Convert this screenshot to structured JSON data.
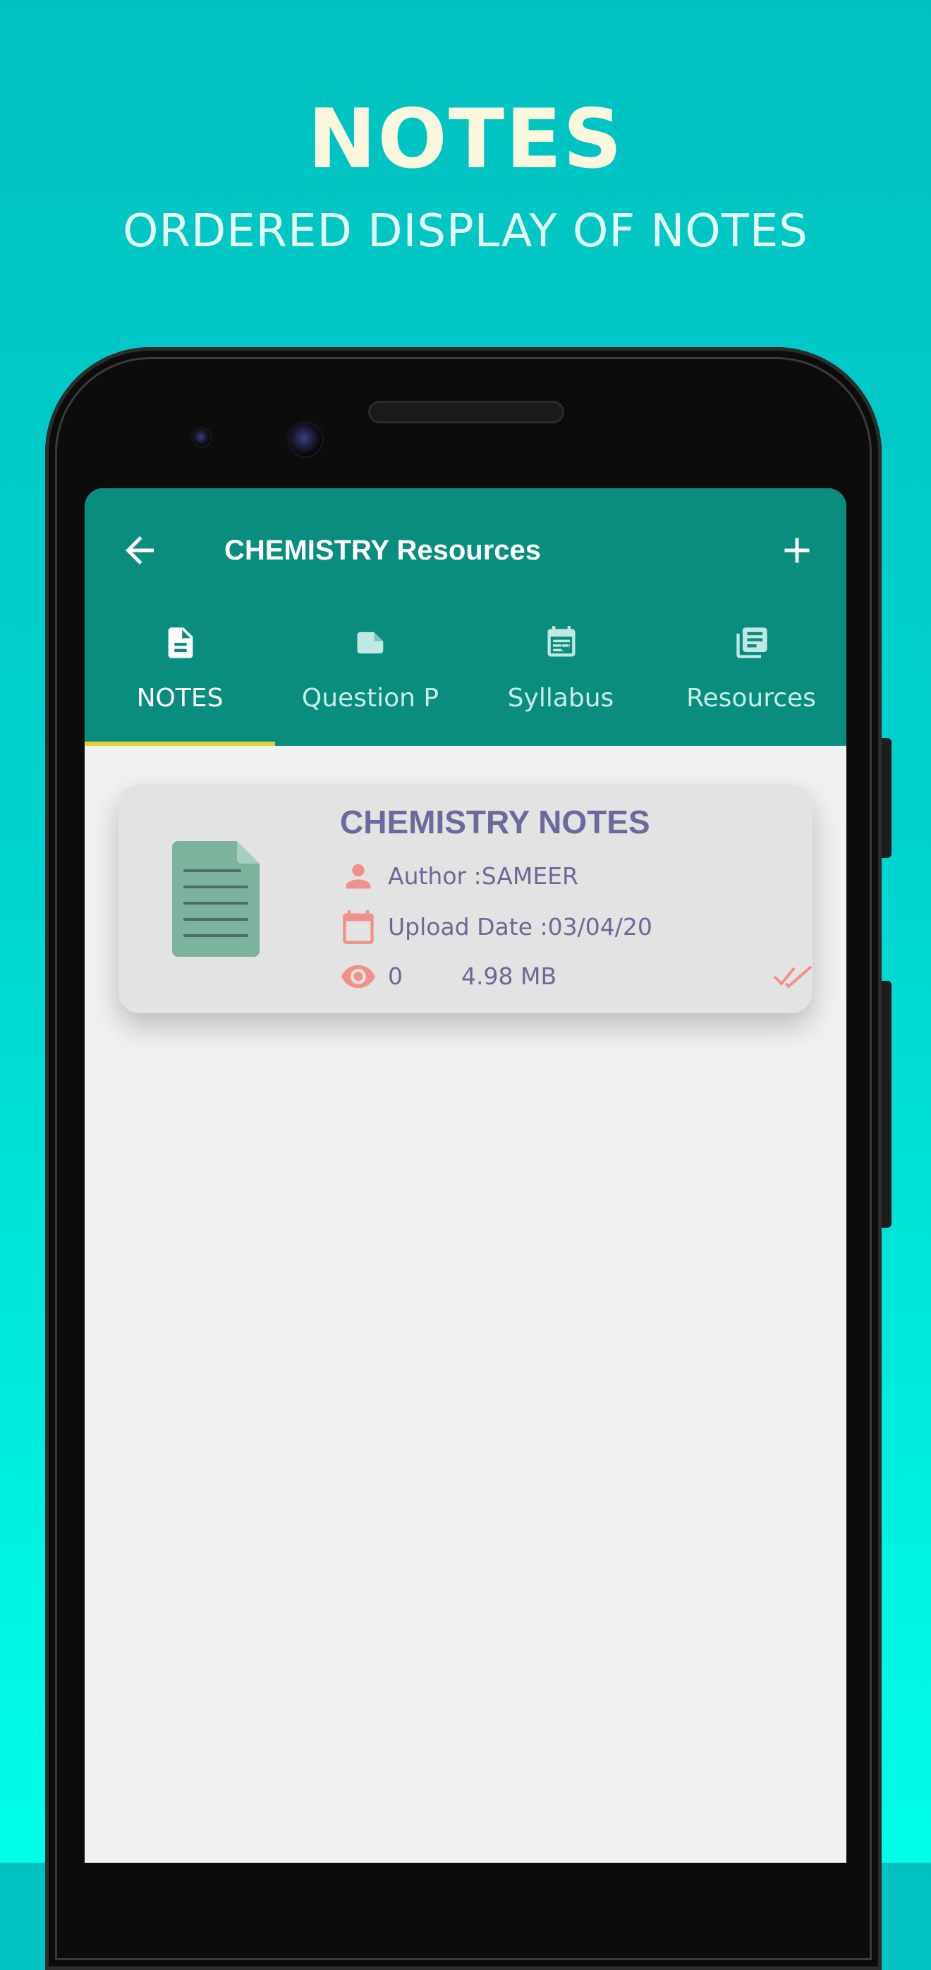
{
  "promo": {
    "title": "NOTES",
    "subtitle": "ORDERED DISPLAY OF NOTES"
  },
  "app_bar": {
    "title": "CHEMISTRY Resources",
    "back_icon": "arrow-back-icon",
    "add_icon": "plus-icon",
    "color": "#0a8d7f"
  },
  "tabs": [
    {
      "label": "NOTES",
      "icon": "document-icon",
      "active": true
    },
    {
      "label": "Question P",
      "icon": "label-icon",
      "active": false
    },
    {
      "label": "Syllabus",
      "icon": "calendar-list-icon",
      "active": false
    },
    {
      "label": "Resources",
      "icon": "library-books-icon",
      "active": false
    }
  ],
  "tab_indicator_color": "#e5cf3b",
  "notes": [
    {
      "title": "CHEMISTRY NOTES",
      "author": "Author :SAMEER",
      "upload_date": "Upload Date :03/04/20",
      "views": "0",
      "size": "4.98 MB",
      "status_icon": "double-check-icon",
      "file_icon": "document-file-icon"
    }
  ],
  "colors": {
    "background_top": "#00c1c0",
    "background_bottom": "#00ffe8",
    "accent_salmon": "#f0928a",
    "card_text": "#6b6a9c",
    "doc_green": "#78b09b"
  }
}
